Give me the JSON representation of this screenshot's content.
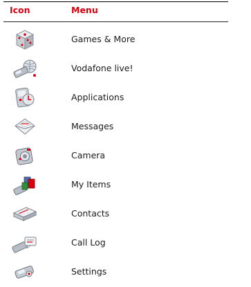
{
  "header": {
    "icon_col": "Icon",
    "menu_col": "Menu"
  },
  "rows": [
    {
      "label": "Games & More",
      "icon": "dice-icon"
    },
    {
      "label": "Vodafone live!",
      "icon": "globe-phone-icon"
    },
    {
      "label": "Applications",
      "icon": "applications-icon"
    },
    {
      "label": "Messages",
      "icon": "envelope-icon"
    },
    {
      "label": "Camera",
      "icon": "camera-icon"
    },
    {
      "label": "My Items",
      "icon": "my-items-icon"
    },
    {
      "label": "Contacts",
      "icon": "contacts-icon"
    },
    {
      "label": "Call Log",
      "icon": "call-log-icon"
    },
    {
      "label": "Settings",
      "icon": "settings-icon"
    }
  ],
  "colors": {
    "header_text": "#d7000f",
    "icon_accent": "#d7000f",
    "icon_body": "#c8cdd3"
  }
}
